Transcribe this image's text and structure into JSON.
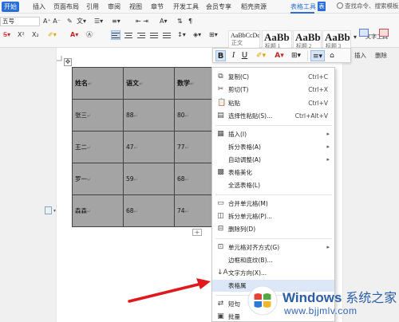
{
  "menu": {
    "items": [
      "开始",
      "插入",
      "页面布局",
      "引用",
      "审阅",
      "视图",
      "章节",
      "开发工具",
      "会员专享",
      "稻壳资源",
      "表格工具",
      "表"
    ],
    "active": "表格工具",
    "search": "查找命令、搜索模板"
  },
  "ribbon": {
    "font_size": "五号",
    "styles": [
      {
        "preview": "AaBbCcDd",
        "name": "正文"
      },
      {
        "preview": "AaBb",
        "name": "标题 1"
      },
      {
        "preview": "AaBb(",
        "name": "标题 2"
      },
      {
        "preview": "AaBbC",
        "name": "标题 3"
      }
    ],
    "text_tools": "文字工具",
    "insert_label": "插入",
    "delete_label": "删除"
  },
  "table": {
    "rows": [
      {
        "name": "姓名",
        "chinese": "语文",
        "math": "数学",
        "header": true
      },
      {
        "name": "张三",
        "chinese": "88",
        "math": "80"
      },
      {
        "name": "王二",
        "chinese": "47",
        "math": "77"
      },
      {
        "name": "罗一",
        "chinese": "59",
        "math": "68"
      },
      {
        "name": "森森",
        "chinese": "68",
        "math": "74"
      }
    ],
    "para_mark": "↵"
  },
  "context_menu": [
    {
      "icon": "copy-icon",
      "label": "复制(C)",
      "shortcut": "Ctrl+C"
    },
    {
      "icon": "cut-icon",
      "label": "剪切(T)",
      "shortcut": "Ctrl+X"
    },
    {
      "icon": "paste-icon",
      "label": "粘贴",
      "shortcut": "Ctrl+V"
    },
    {
      "icon": "paste-special-icon",
      "label": "选择性粘贴(S)...",
      "shortcut": "Ctrl+Alt+V"
    },
    {
      "icon": "insert-table-icon",
      "label": "插入(I)",
      "submenu": true
    },
    {
      "icon": "",
      "label": "拆分表格(A)",
      "submenu": true
    },
    {
      "icon": "",
      "label": "自动调整(A)",
      "submenu": true
    },
    {
      "icon": "table-beautify-icon",
      "label": "表格美化"
    },
    {
      "icon": "",
      "label": "全选表格(L)"
    },
    {
      "icon": "merge-cells-icon",
      "label": "合并单元格(M)"
    },
    {
      "icon": "split-cells-icon",
      "label": "拆分单元格(P)..."
    },
    {
      "icon": "delete-column-icon",
      "label": "删除列(D)"
    },
    {
      "icon": "cell-align-icon",
      "label": "单元格对齐方式(G)",
      "submenu": true
    },
    {
      "icon": "",
      "label": "边框和底纹(B)..."
    },
    {
      "icon": "text-direction-icon",
      "label": "文字方向(X)..."
    },
    {
      "icon": "",
      "label": "表格属",
      "hover": true
    },
    {
      "icon": "short-text-icon",
      "label": "短句"
    },
    {
      "icon": "batch-icon",
      "label": "批量"
    }
  ],
  "watermark": {
    "brand": "Windows",
    "brand_cn": "系统之家",
    "url": "www.bjjmlv.com",
    "logo_colors": [
      "#e2443a",
      "#54a93e",
      "#2f79d6",
      "#f2b62b"
    ]
  }
}
